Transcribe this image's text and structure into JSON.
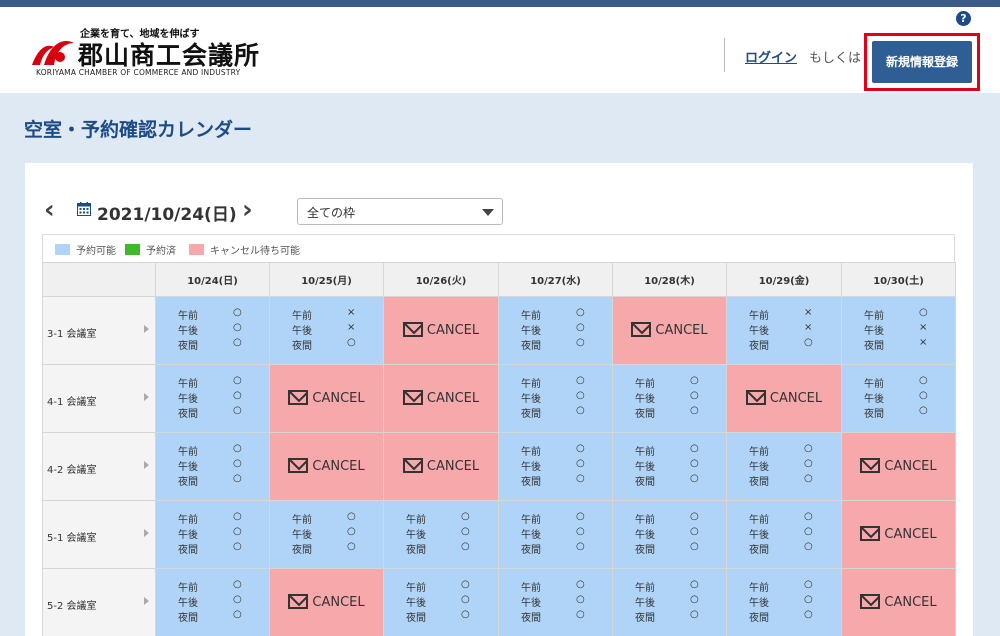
{
  "header": {
    "logo_tagline": "企業を育て、地域を伸ばす",
    "logo_name": "郡山商工会議所",
    "logo_english": "KORIYAMA CHAMBER OF COMMERCE AND INDUSTRY",
    "help_label": "?",
    "login_label": "ログイン",
    "or_label": "もしくは",
    "register_label": "新規情報登録",
    "accent_color": "#2f5e95",
    "highlight_color": "#e1001a"
  },
  "page": {
    "title": "空室・予約確認カレンダー"
  },
  "calendar": {
    "prev_label": "‹",
    "next_label": "›",
    "current_date": "2021/10/24(日)",
    "filter_value": "全ての枠",
    "legend": [
      {
        "label": "予約可能",
        "color": "#afd4f8"
      },
      {
        "label": "予約済",
        "color": "#3fb82b"
      },
      {
        "label": "キャンセル待ち可能",
        "color": "#f7a8ab"
      }
    ],
    "days": [
      "10/24(日)",
      "10/25(月)",
      "10/26(火)",
      "10/27(水)",
      "10/28(木)",
      "10/29(金)",
      "10/30(土)"
    ],
    "slot_names": [
      "午前",
      "午後",
      "夜間"
    ],
    "cancel_label": "CANCEL",
    "rooms": [
      {
        "name": "3-1 会議室",
        "cells": [
          {
            "type": "avail",
            "marks": [
              "○",
              "○",
              "○"
            ]
          },
          {
            "type": "avail",
            "marks": [
              "×",
              "×",
              "○"
            ]
          },
          {
            "type": "cancel"
          },
          {
            "type": "avail",
            "marks": [
              "○",
              "○",
              "○"
            ]
          },
          {
            "type": "cancel"
          },
          {
            "type": "avail",
            "marks": [
              "×",
              "×",
              "○"
            ]
          },
          {
            "type": "avail",
            "marks": [
              "○",
              "×",
              "×"
            ]
          }
        ]
      },
      {
        "name": "4-1 会議室",
        "cells": [
          {
            "type": "avail",
            "marks": [
              "○",
              "○",
              "○"
            ]
          },
          {
            "type": "cancel"
          },
          {
            "type": "cancel"
          },
          {
            "type": "avail",
            "marks": [
              "○",
              "○",
              "○"
            ]
          },
          {
            "type": "avail",
            "marks": [
              "○",
              "○",
              "○"
            ]
          },
          {
            "type": "cancel"
          },
          {
            "type": "avail",
            "marks": [
              "○",
              "○",
              "○"
            ]
          }
        ]
      },
      {
        "name": "4-2 会議室",
        "cells": [
          {
            "type": "avail",
            "marks": [
              "○",
              "○",
              "○"
            ]
          },
          {
            "type": "cancel"
          },
          {
            "type": "cancel"
          },
          {
            "type": "avail",
            "marks": [
              "○",
              "○",
              "○"
            ]
          },
          {
            "type": "avail",
            "marks": [
              "○",
              "○",
              "○"
            ]
          },
          {
            "type": "avail",
            "marks": [
              "○",
              "○",
              "○"
            ]
          },
          {
            "type": "cancel"
          }
        ]
      },
      {
        "name": "5-1 会議室",
        "cells": [
          {
            "type": "avail",
            "marks": [
              "○",
              "○",
              "○"
            ]
          },
          {
            "type": "avail",
            "marks": [
              "○",
              "○",
              "○"
            ]
          },
          {
            "type": "avail",
            "marks": [
              "○",
              "○",
              "○"
            ]
          },
          {
            "type": "avail",
            "marks": [
              "○",
              "○",
              "○"
            ]
          },
          {
            "type": "avail",
            "marks": [
              "○",
              "○",
              "○"
            ]
          },
          {
            "type": "avail",
            "marks": [
              "○",
              "○",
              "○"
            ]
          },
          {
            "type": "cancel"
          }
        ]
      },
      {
        "name": "5-2 会議室",
        "cells": [
          {
            "type": "avail",
            "marks": [
              "○",
              "○",
              "○"
            ]
          },
          {
            "type": "cancel"
          },
          {
            "type": "avail",
            "marks": [
              "○",
              "○",
              "○"
            ]
          },
          {
            "type": "avail",
            "marks": [
              "○",
              "○",
              "○"
            ]
          },
          {
            "type": "avail",
            "marks": [
              "○",
              "○",
              "○"
            ]
          },
          {
            "type": "avail",
            "marks": [
              "○",
              "○",
              "○"
            ]
          },
          {
            "type": "cancel"
          }
        ]
      }
    ]
  }
}
